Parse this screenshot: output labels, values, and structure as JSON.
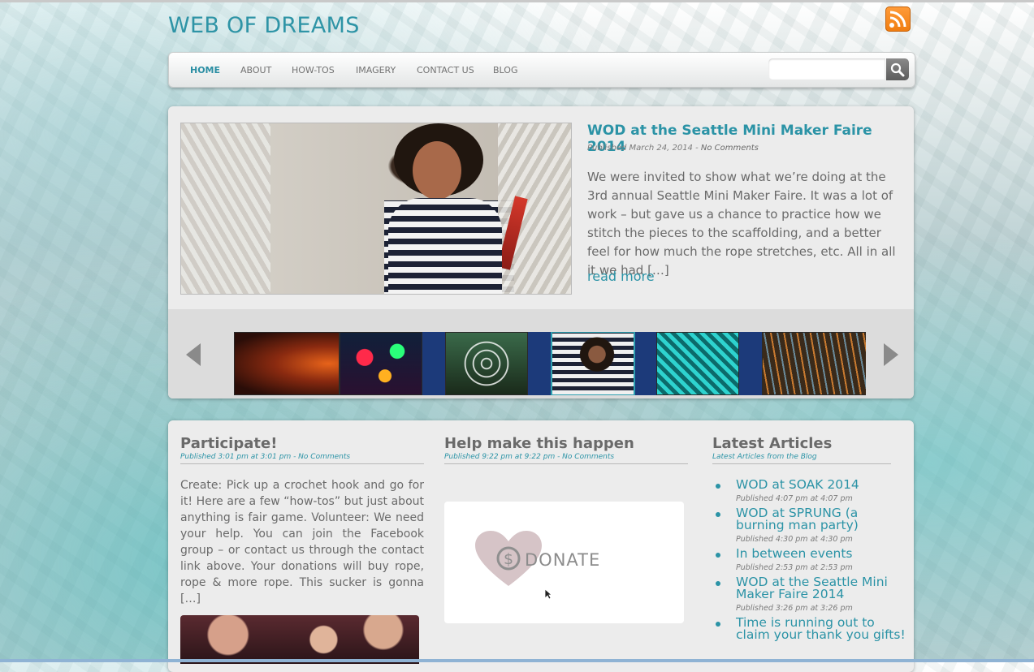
{
  "site": {
    "title": "WEB OF DREAMS"
  },
  "icons": {
    "rss": "rss-icon",
    "search": "magnifier-icon",
    "prev": "arrow-left-icon",
    "next": "arrow-right-icon",
    "donate": "heart-dollar-icon"
  },
  "colors": {
    "accent": "#2b93a6",
    "rss": "#f58a1f",
    "text": "#6a6a6a"
  },
  "nav": {
    "items": [
      {
        "label": "HOME",
        "active": true
      },
      {
        "label": "ABOUT"
      },
      {
        "label": "HOW-TOS"
      },
      {
        "label": "IMAGERY"
      },
      {
        "label": "CONTACT US"
      },
      {
        "label": "BLOG"
      }
    ],
    "search": {
      "value": "",
      "placeholder": ""
    }
  },
  "featured": {
    "title": "WOD at the Seattle Mini Maker Faire 2014",
    "meta_published": "Published March 24, 2014 - ",
    "meta_comments": "No Comments",
    "excerpt": "We were invited to show what we’re doing at the 3rd annual Seattle Mini Maker Faire. It was a lot of work – but gave us a chance to practice how we stitch the pieces to the scaffolding, and a better feel for how much the rope stretches, etc. All in all it we had […]",
    "read_more": "read more",
    "selected_thumbnail": 4,
    "thumbnail_count": 6
  },
  "widgets": {
    "participate": {
      "title": "Participate!",
      "meta": "Published 3:01 pm at 3:01 pm - No Comments",
      "text": "Create: Pick up a crochet hook and go for it! Here are a few “how-tos” but just about anything is fair game. Volunteer: We need your help. You can join the Facebook group – or contact us through the contact link above. Your donations will buy rope, rope & more rope. This sucker is gonna […]"
    },
    "help": {
      "title": "Help make this happen",
      "meta": "Published 9:22 pm at 9:22 pm - No Comments",
      "donate_label": "DONATE"
    },
    "latest": {
      "title": "Latest Articles",
      "subtitle": "Latest Articles from the Blog",
      "articles": [
        {
          "title": "WOD at SOAK 2014",
          "meta": "Published 4:07 pm at 4:07 pm"
        },
        {
          "title": "WOD at SPRUNG (a burning man party)",
          "meta": "Published 4:30 pm at 4:30 pm"
        },
        {
          "title": "In between events",
          "meta": "Published 2:53 pm at 2:53 pm"
        },
        {
          "title": "WOD at the Seattle Mini Maker Faire 2014",
          "meta": "Published 3:26 pm at 3:26 pm"
        },
        {
          "title": "Time is running out to claim your thank you gifts!",
          "meta": ""
        }
      ]
    }
  }
}
